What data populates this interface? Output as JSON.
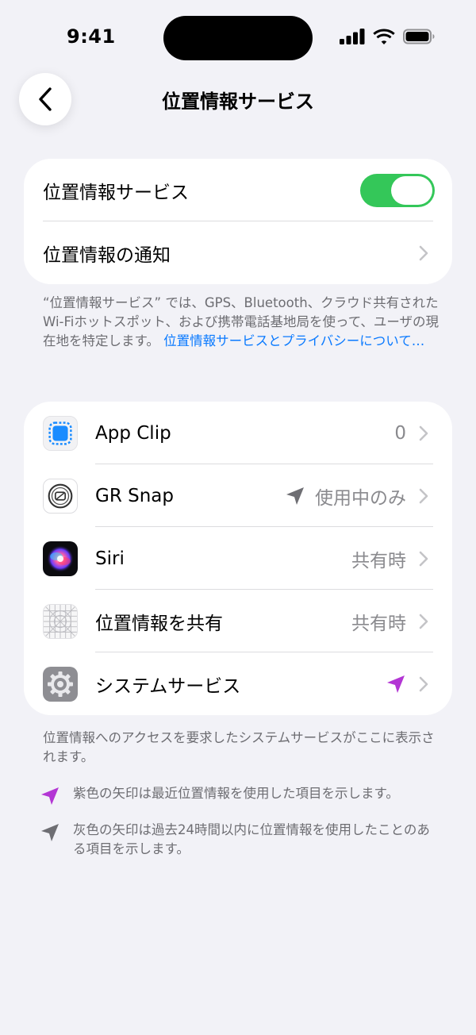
{
  "status_bar": {
    "time": "9:41"
  },
  "nav": {
    "title": "位置情報サービス"
  },
  "main_card": {
    "toggle_label": "位置情報サービス",
    "toggle_on": true,
    "notify_label": "位置情報の通知"
  },
  "description": {
    "text": "“位置情報サービス” では、GPS、Bluetooth、クラウド共有されたWi-Fiホットスポット、および携帯電話基地局を使って、ユーザの現在地を特定します。",
    "link": "位置情報サービスとプライバシーについて…"
  },
  "apps": [
    {
      "name": "App Clip",
      "value": "0",
      "arrow": "",
      "icon": "app-clip-icon"
    },
    {
      "name": "GR Snap",
      "value": "使用中のみ",
      "arrow": "gray",
      "icon": "gr-snap-icon"
    },
    {
      "name": "Siri",
      "value": "共有時",
      "arrow": "",
      "icon": "siri-icon"
    },
    {
      "name": "位置情報を共有",
      "value": "共有時",
      "arrow": "",
      "icon": "share-location-icon"
    },
    {
      "name": "システムサービス",
      "value": "",
      "arrow": "purple",
      "icon": "system-services-icon"
    }
  ],
  "apps_footnote": "位置情報へのアクセスを要求したシステムサービスがここに表示されます。",
  "legend": {
    "purple": "紫色の矢印は最近位置情報を使用した項目を示します。",
    "gray": "灰色の矢印は過去24時間以内に位置情報を使用したことのある項目を示します。"
  },
  "colors": {
    "accent": "#0a7aff",
    "toggle_on": "#34c759",
    "purple_arrow": "#b336d4",
    "gray_arrow": "#6e6e73"
  }
}
